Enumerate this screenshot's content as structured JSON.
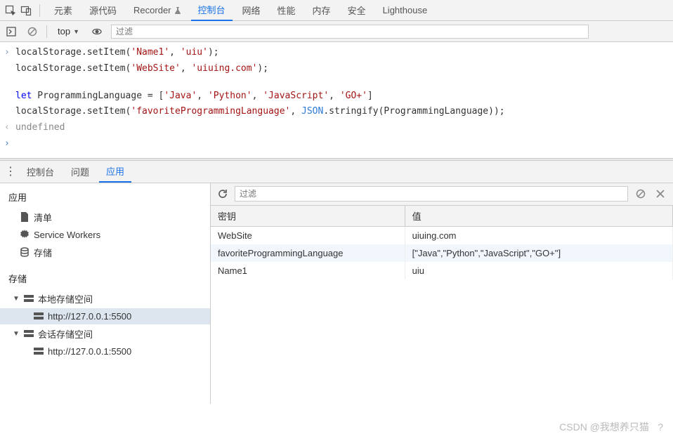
{
  "top_tabs": {
    "elements": "元素",
    "sources": "源代码",
    "recorder": "Recorder",
    "console": "控制台",
    "network": "网络",
    "performance": "性能",
    "memory": "内存",
    "security": "安全",
    "lighthouse": "Lighthouse"
  },
  "console_bar": {
    "context": "top",
    "filter_placeholder": "过滤"
  },
  "console_code": {
    "line1_a": "localStorage.setItem(",
    "line1_s1": "'Name1'",
    "line1_c": ", ",
    "line1_s2": "'uiu'",
    "line1_e": ");",
    "line2_a": "localStorage.setItem(",
    "line2_s1": "'WebSite'",
    "line2_c": ", ",
    "line2_s2": "'uiuing.com'",
    "line2_e": ");",
    "line3_kw": "let",
    "line3_var": " ProgrammingLanguage = [",
    "line3_s1": "'Java'",
    "line3_c1": ", ",
    "line3_s2": "'Python'",
    "line3_c2": ", ",
    "line3_s3": "'JavaScript'",
    "line3_c3": ", ",
    "line3_s4": "'GO+'",
    "line3_e": "]",
    "line4_a": "localStorage.setItem(",
    "line4_s1": "'favoriteProgrammingLanguage'",
    "line4_c": ", ",
    "line4_json": "JSON",
    "line4_strfn": ".stringify(ProgrammingLanguage));",
    "result": "undefined"
  },
  "drawer_tabs": {
    "console": "控制台",
    "issues": "问题",
    "application": "应用"
  },
  "sidebar": {
    "app_title": "应用",
    "manifest": "清单",
    "service_workers": "Service Workers",
    "storage": "存储",
    "storage_title": "存储",
    "local_storage": "本地存储空间",
    "local_storage_item": "http://127.0.0.1:5500",
    "session_storage": "会话存储空间",
    "session_storage_item": "http://127.0.0.1:5500"
  },
  "table": {
    "filter_placeholder": "过滤",
    "col_key": "密钥",
    "col_value": "值",
    "rows": [
      {
        "k": "WebSite",
        "v": "uiuing.com"
      },
      {
        "k": "favoriteProgrammingLanguage",
        "v": "[\"Java\",\"Python\",\"JavaScript\",\"GO+\"]"
      },
      {
        "k": "Name1",
        "v": "uiu"
      }
    ]
  },
  "watermark": "CSDN @我想养只猫    ?"
}
